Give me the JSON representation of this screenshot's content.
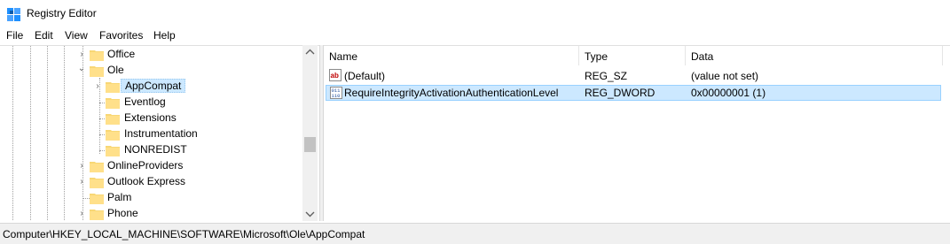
{
  "window": {
    "title": "Registry Editor"
  },
  "menu": [
    "File",
    "Edit",
    "View",
    "Favorites",
    "Help"
  ],
  "tree": {
    "items": [
      {
        "label": "Office",
        "expander": "›"
      },
      {
        "label": "Ole",
        "expander": "⌄"
      },
      {
        "label": "AppCompat",
        "expander": "›"
      },
      {
        "label": "Eventlog"
      },
      {
        "label": "Extensions"
      },
      {
        "label": "Instrumentation"
      },
      {
        "label": "NONREDIST"
      },
      {
        "label": "OnlineProviders",
        "expander": "›"
      },
      {
        "label": "Outlook Express",
        "expander": "›"
      },
      {
        "label": "Palm"
      },
      {
        "label": "Phone",
        "expander": "›"
      }
    ]
  },
  "list": {
    "headers": {
      "name": "Name",
      "type": "Type",
      "data": "Data"
    },
    "rows": [
      {
        "icon": "string-value-icon",
        "name": "(Default)",
        "type": "REG_SZ",
        "data": "(value not set)"
      },
      {
        "icon": "binary-value-icon",
        "name": "RequireIntegrityActivationAuthenticationLevel",
        "type": "REG_DWORD",
        "data": "0x00000001 (1)"
      }
    ]
  },
  "status": {
    "path": "Computer\\HKEY_LOCAL_MACHINE\\SOFTWARE\\Microsoft\\Ole\\AppCompat"
  },
  "colors": {
    "selection": "#cce8ff",
    "folder": "#f8d775",
    "accent": "#0078d7"
  }
}
